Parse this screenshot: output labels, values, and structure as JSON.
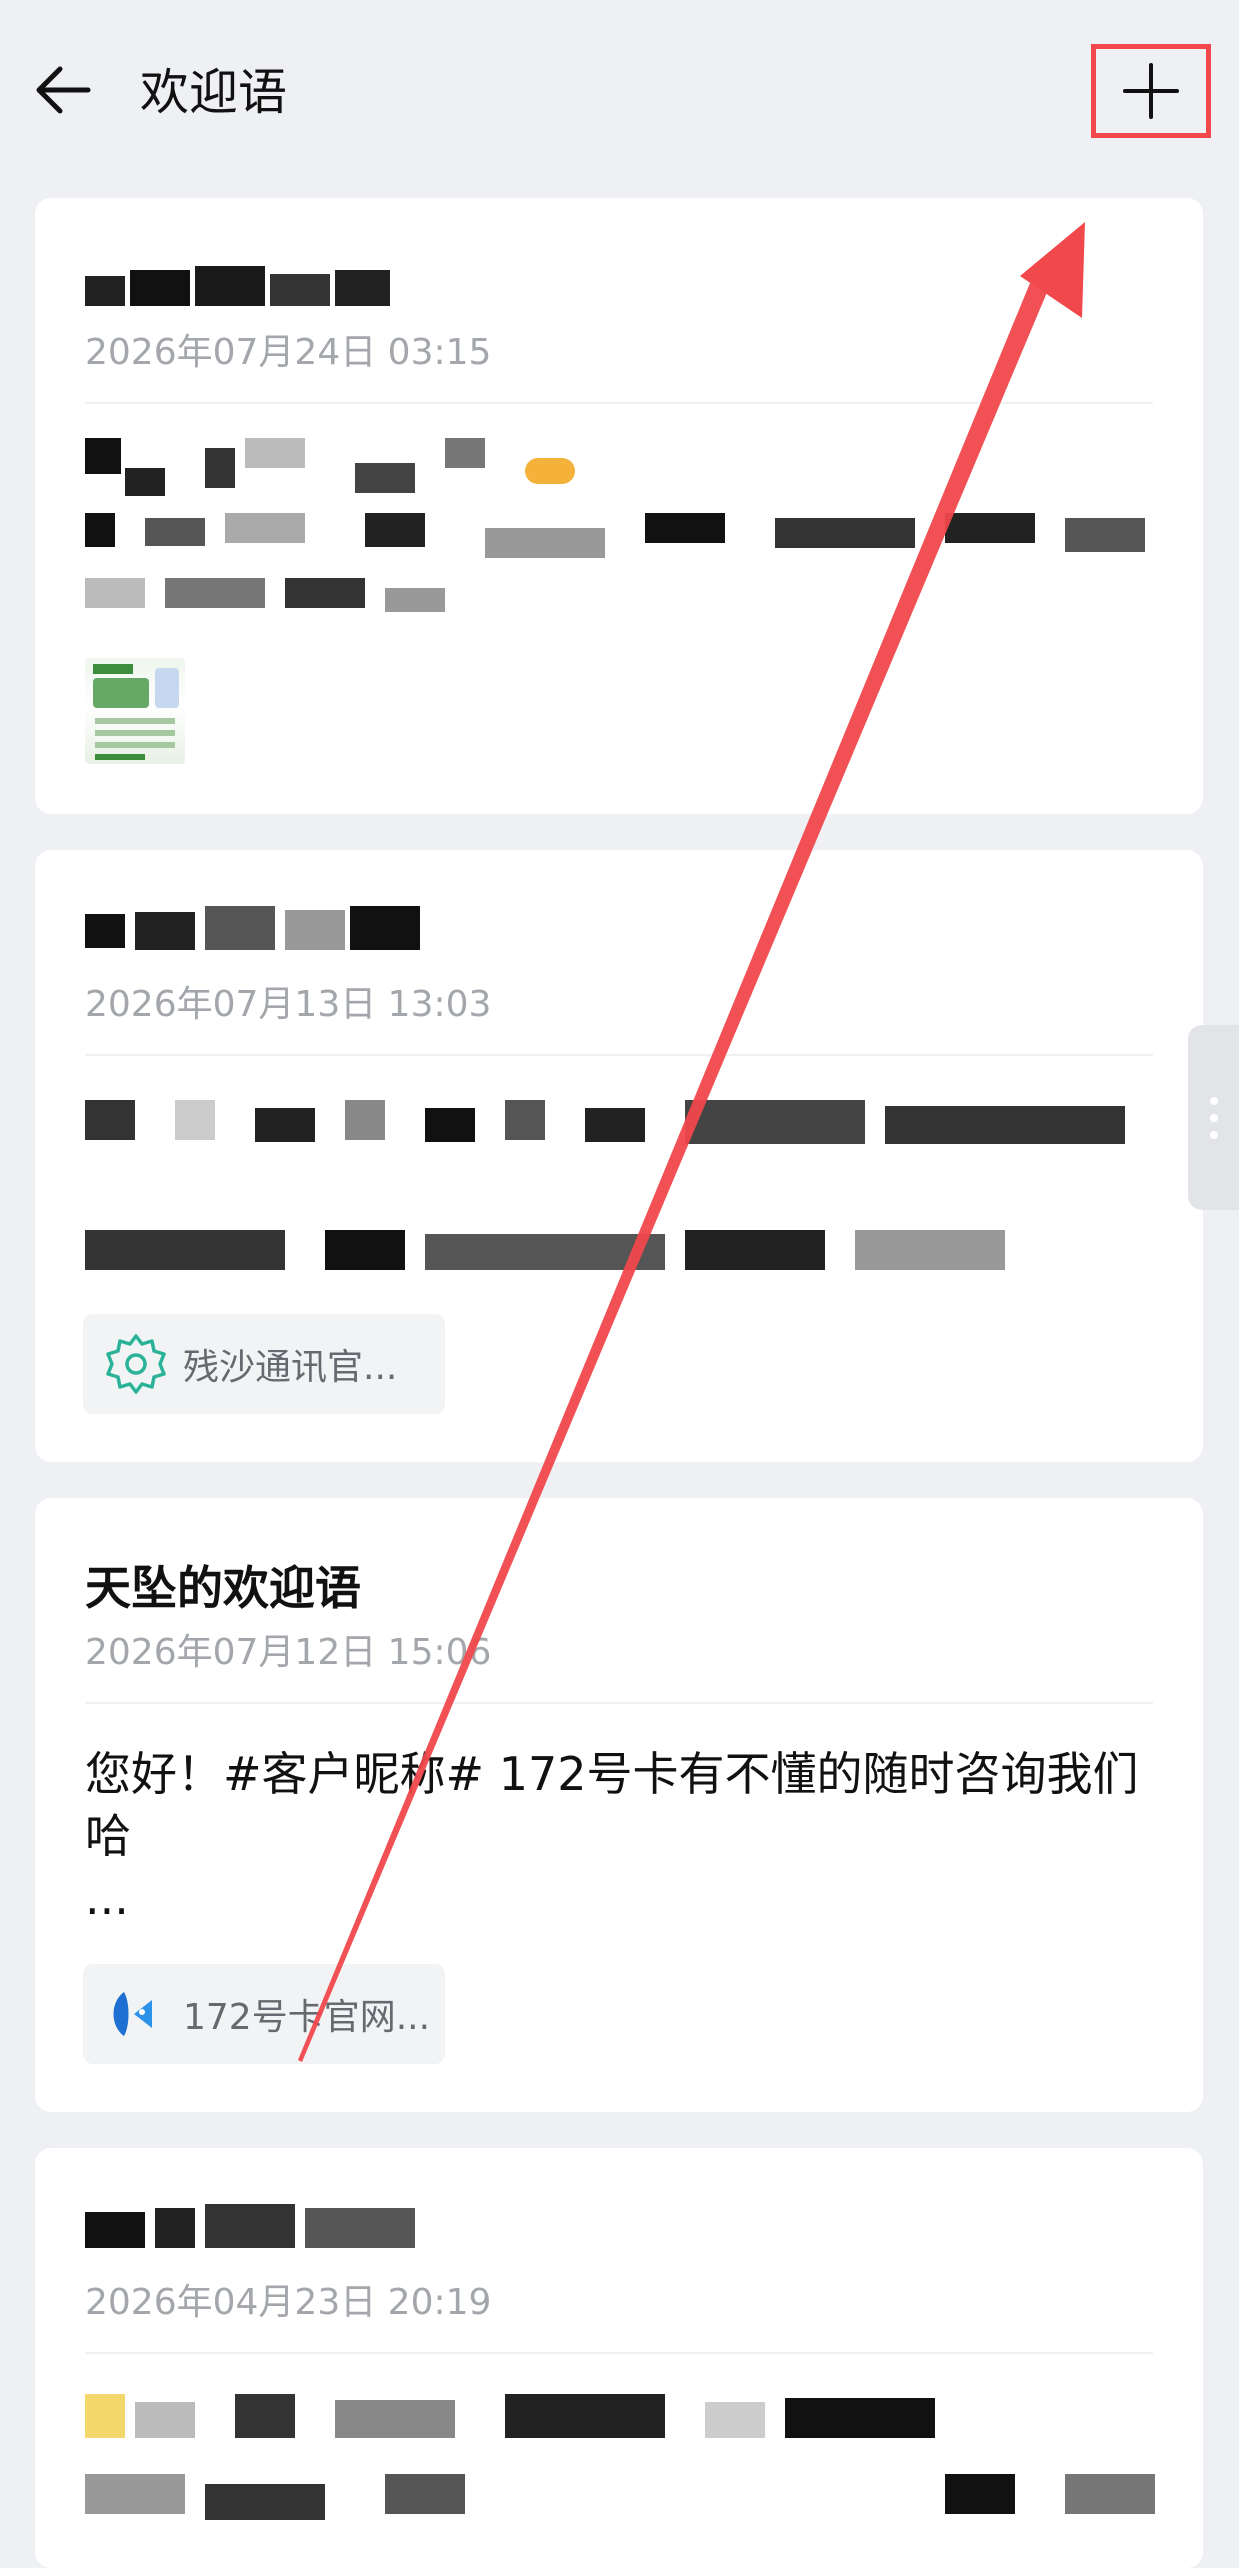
{
  "colors": {
    "background": "#eef0f4",
    "card": "#ffffff",
    "annotation_red": "#f0484b",
    "timestamp_gray": "#a3a6ab",
    "attachment_bg": "#f2f3f5"
  },
  "header": {
    "back_icon": "arrow-left-icon",
    "title": "欢迎语",
    "add_icon": "plus-icon"
  },
  "cards": [
    {
      "title": "",
      "time": "2026年07月24日 03:15",
      "has_image_thumbnail": true
    },
    {
      "title": "",
      "time": "2026年07月13日 13:03",
      "attachment": {
        "icon": "gear-icon",
        "label": "残沙通讯官..."
      }
    },
    {
      "title": "天坠的欢迎语",
      "time": "2026年07月12日 15:06",
      "message": "您好！#客户昵称#  172号卡有不懂的随时咨询我们哈\n...",
      "attachment": {
        "icon": "fish-logo-icon",
        "label": "172号卡官网..."
      }
    },
    {
      "title": "",
      "time": "2026年04月23日 20:19"
    }
  ]
}
